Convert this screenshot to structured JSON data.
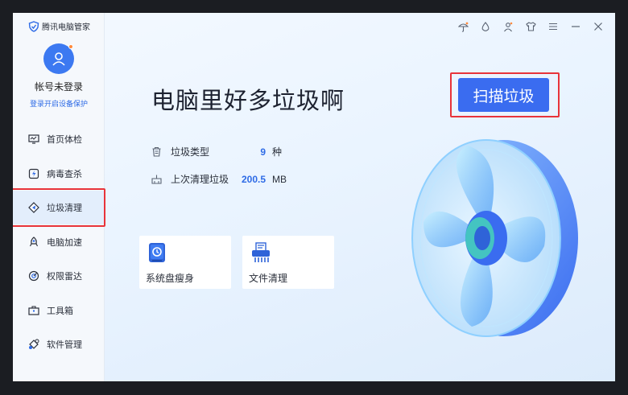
{
  "app": {
    "brand": "腾讯电脑管家"
  },
  "account": {
    "name": "帐号未登录",
    "login_link": "登录开启设备保护"
  },
  "sidebar": {
    "items": [
      {
        "label": "首页体检",
        "icon": "monitor-icon"
      },
      {
        "label": "病毒查杀",
        "icon": "shield-bolt-icon"
      },
      {
        "label": "垃圾清理",
        "icon": "broom-icon"
      },
      {
        "label": "电脑加速",
        "icon": "rocket-icon"
      },
      {
        "label": "权限雷达",
        "icon": "radar-icon"
      },
      {
        "label": "工具箱",
        "icon": "toolbox-icon"
      },
      {
        "label": "软件管理",
        "icon": "apps-icon"
      }
    ],
    "active_index": 2
  },
  "titlebar": {
    "icons": [
      "umbrella-icon",
      "drop-icon",
      "person-icon",
      "shirt-icon",
      "menu-icon",
      "minimize-icon",
      "close-icon"
    ]
  },
  "main": {
    "headline": "电脑里好多垃圾啊",
    "scan_button": "扫描垃圾",
    "stats": [
      {
        "label": "垃圾类型",
        "value": "9",
        "unit": "种"
      },
      {
        "label": "上次清理垃圾",
        "value": "200.5",
        "unit": "MB"
      }
    ],
    "tools": [
      {
        "label": "系统盘瘦身",
        "icon": "disk-icon"
      },
      {
        "label": "文件清理",
        "icon": "shredder-icon"
      }
    ]
  },
  "colors": {
    "accent": "#3a6cf0",
    "highlight": "#e8343a",
    "link": "#2e6be6"
  }
}
